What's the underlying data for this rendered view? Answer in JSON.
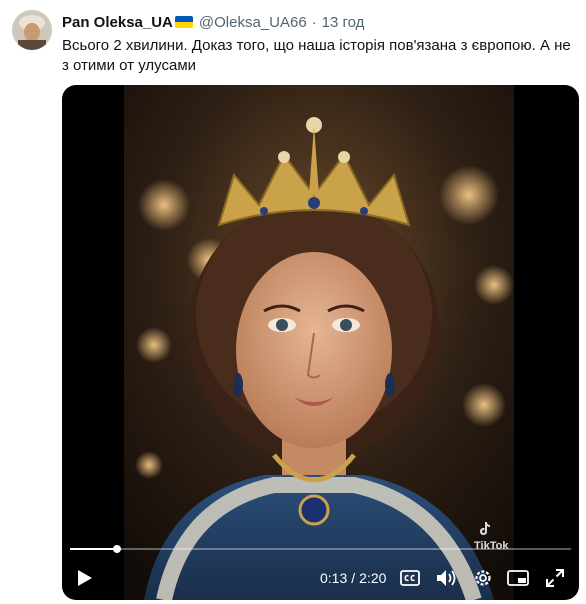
{
  "tweet": {
    "display_name": "Pan Oleksa_UA",
    "flag_icon": "ukraine-flag-icon",
    "handle": "@Oleksa_UA66",
    "separator": "·",
    "timestamp": "13 год",
    "text": "Всього 2 хвилини. Доказ того, що наша історія пов'язана з європою. А не з отими от улусами"
  },
  "video": {
    "current_time": "0:13",
    "time_separator": "/",
    "duration": "2:20",
    "progress_fraction": 0.093,
    "watermark": "TikTok",
    "controls": {
      "play_icon": "play-icon",
      "captions_icon": "closed-captions-icon",
      "volume_icon": "volume-icon",
      "settings_icon": "gear-icon",
      "pip_icon": "picture-in-picture-icon",
      "fullscreen_icon": "fullscreen-icon"
    }
  },
  "colors": {
    "text": "#0f1419",
    "muted": "#536471",
    "video_bg": "#000000",
    "flag_blue": "#0057b7",
    "flag_yellow": "#ffd700"
  }
}
